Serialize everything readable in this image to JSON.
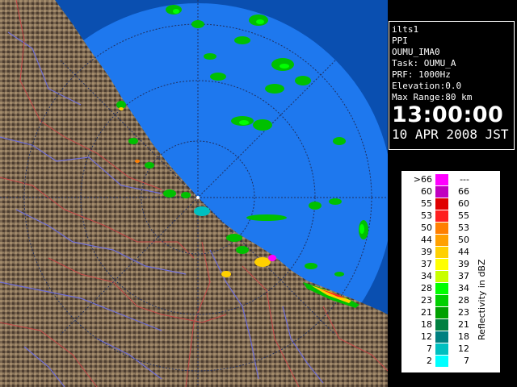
{
  "info_panel": {
    "radar_name": "ilts1",
    "scan_type": "PPI",
    "site_name": "OUMU_IMA0",
    "task": "Task: OUMU_A",
    "prf": "PRF: 1000Hz",
    "elevation": "Elevation:0.0",
    "max_range": "Max Range:80 km",
    "time": "13:00:00",
    "date": "10 APR 2008 JST"
  },
  "legend": {
    "title": "Reflectivity in dBZ",
    "rows": [
      {
        "low": ">66",
        "high": "---",
        "color": "#ff00ff"
      },
      {
        "low": "60",
        "high": "66",
        "color": "#c000c0"
      },
      {
        "low": "55",
        "high": "60",
        "color": "#e00000"
      },
      {
        "low": "53",
        "high": "55",
        "color": "#ff2020"
      },
      {
        "low": "50",
        "high": "53",
        "color": "#ff7f00"
      },
      {
        "low": "44",
        "high": "50",
        "color": "#ffa000"
      },
      {
        "low": "39",
        "high": "44",
        "color": "#ffd000"
      },
      {
        "low": "37",
        "high": "39",
        "color": "#ffff00"
      },
      {
        "low": "34",
        "high": "37",
        "color": "#c8ff00"
      },
      {
        "low": "28",
        "high": "34",
        "color": "#00ff00"
      },
      {
        "low": "23",
        "high": "28",
        "color": "#00d000"
      },
      {
        "low": "21",
        "high": "23",
        "color": "#00a000"
      },
      {
        "low": "18",
        "high": "21",
        "color": "#008040"
      },
      {
        "low": "12",
        "high": "18",
        "color": "#008080"
      },
      {
        "low": "7",
        "high": "12",
        "color": "#00c0c0"
      },
      {
        "low": "2",
        "high": "7",
        "color": "#00ffff"
      }
    ]
  },
  "colors": {
    "sea": "#1e78ee",
    "sea_outer": "#0a4fb0",
    "terrain_dark": "#5a4838",
    "terrain_light": "#a08868",
    "rivers": "#6f6fd8",
    "borders": "#c84848",
    "range_rings": "#203060"
  },
  "icons": {
    "radar_site": "radar-site-marker-icon"
  }
}
